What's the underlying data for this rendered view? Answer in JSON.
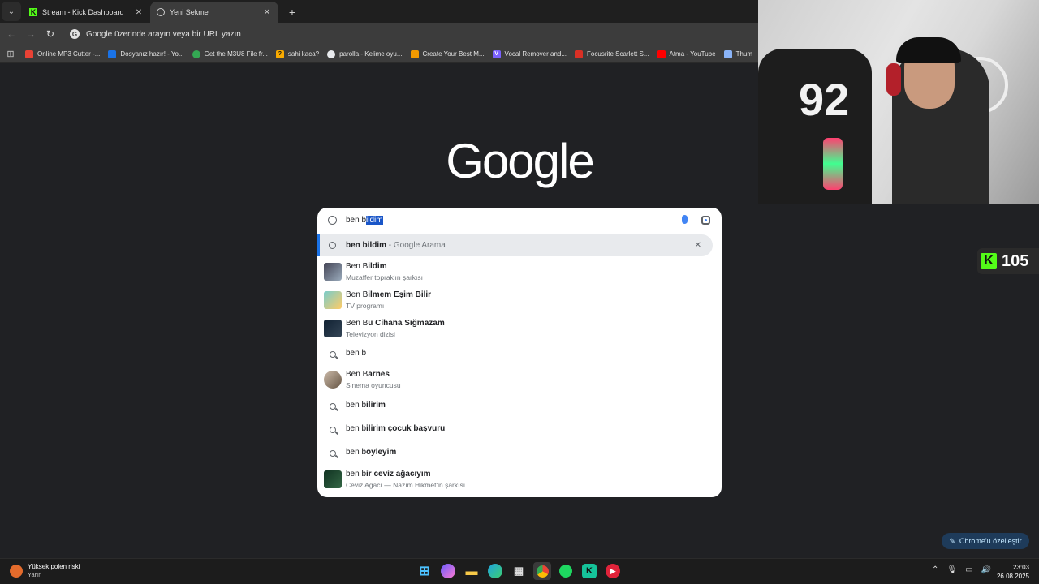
{
  "tabs": [
    {
      "title": "Stream - Kick Dashboard",
      "favicon": "kick-icon",
      "active": false
    },
    {
      "title": "Yeni Sekme",
      "favicon": "chrome-icon",
      "active": true
    }
  ],
  "omnibox": {
    "text": "Google üzerinde arayın veya bir URL yazın"
  },
  "bookmarks": [
    {
      "label": "Online MP3 Cutter -...",
      "color": "#e94235"
    },
    {
      "label": "Dosyanız hazır! - Yo...",
      "color": "#1a73e8"
    },
    {
      "label": "Get the M3U8 File fr...",
      "color": "#34a853"
    },
    {
      "label": "sahi kaca?",
      "color": "#f9ab00"
    },
    {
      "label": "parolla - Kelime oyu...",
      "color": "#e8eaed"
    },
    {
      "label": "Create Your Best M...",
      "color": "#f29900"
    },
    {
      "label": "Vocal Remover and...",
      "color": "#7b61ff"
    },
    {
      "label": "Focusrite Scarlett S...",
      "color": "#d93025"
    },
    {
      "label": "Atma - YouTube",
      "color": "#ff0000"
    },
    {
      "label": "Thum",
      "color": "#8ab4f8"
    }
  ],
  "logo": "Google",
  "search": {
    "query_prefix": "ben ",
    "query_cursor": "b",
    "query_selected": "ildim"
  },
  "suggestions": [
    {
      "type": "history",
      "bold": "ben bildim",
      "normal": "",
      "suffix": " - Google Arama",
      "sub": ""
    },
    {
      "type": "entity",
      "normal": "Ben B",
      "bold": "ildim",
      "suffix": "",
      "sub": "Muzaffer toprak'ın şarkısı"
    },
    {
      "type": "entity",
      "normal": "Ben B",
      "bold": "ilmem Eşim Bilir",
      "suffix": "",
      "sub": "TV programı"
    },
    {
      "type": "entity",
      "normal": "Ben B",
      "bold": "u Cihana Sığmazam",
      "suffix": "",
      "sub": "Televizyon dizisi"
    },
    {
      "type": "search",
      "normal": "ben b",
      "bold": "",
      "suffix": "",
      "sub": ""
    },
    {
      "type": "entity",
      "normal": "Ben B",
      "bold": "arnes",
      "suffix": "",
      "sub": "Sinema oyuncusu"
    },
    {
      "type": "search",
      "normal": "ben b",
      "bold": "ilirim",
      "suffix": "",
      "sub": ""
    },
    {
      "type": "search",
      "normal": "ben b",
      "bold": "ilirim çocuk başvuru",
      "suffix": "",
      "sub": ""
    },
    {
      "type": "search",
      "normal": "ben b",
      "bold": "öyleyim",
      "suffix": "",
      "sub": ""
    },
    {
      "type": "entity",
      "normal": "ben b",
      "bold": "ir ceviz ağacıyım",
      "suffix": "",
      "sub": "Ceviz Ağacı — Nâzım Hikmet'in şarkısı"
    }
  ],
  "webcam": {
    "jersey_number": "92"
  },
  "kick_badge": {
    "count": "105"
  },
  "customize_button": "Chrome'u özelleştir",
  "taskbar": {
    "weather_title": "Yüksek polen riski",
    "weather_sub": "Yarın",
    "time": "23:03",
    "date": "26.08.2025"
  }
}
